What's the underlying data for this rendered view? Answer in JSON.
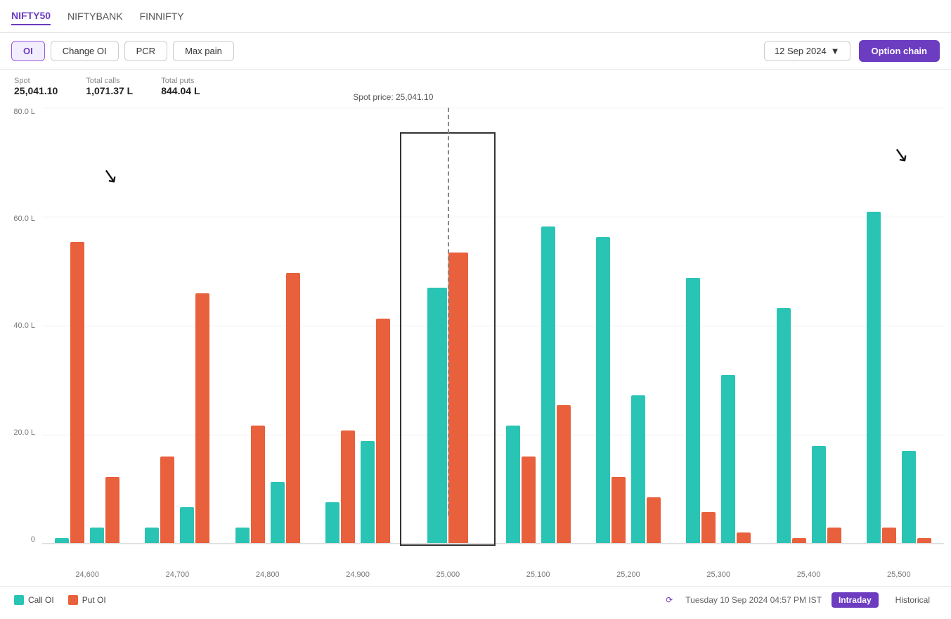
{
  "nav": {
    "items": [
      {
        "label": "NIFTY50",
        "active": true
      },
      {
        "label": "NIFTYBANK",
        "active": false
      },
      {
        "label": "FINNIFTY",
        "active": false
      }
    ]
  },
  "toolbar": {
    "filters": [
      {
        "label": "OI",
        "active": true
      },
      {
        "label": "Change OI",
        "active": false
      },
      {
        "label": "PCR",
        "active": false
      },
      {
        "label": "Max pain",
        "active": false
      }
    ],
    "date": "12 Sep 2024",
    "option_chain_btn": "Option chain"
  },
  "stats": {
    "spot_label": "Spot",
    "spot_value": "25,041.10",
    "total_calls_label": "Total calls",
    "total_calls_value": "1,071.37 L",
    "total_puts_label": "Total puts",
    "total_puts_value": "844.04 L"
  },
  "chart": {
    "spot_price_label": "Spot price: 25,041.10",
    "y_labels": [
      "80.0 L",
      "60.0 L",
      "40.0 L",
      "20.0 L",
      "0"
    ],
    "x_labels": [
      "24,600",
      "24,700",
      "24,800",
      "24,900",
      "25,000",
      "25,100",
      "25,200",
      "25,300",
      "25,400",
      "25,500"
    ],
    "highlighted_strike": "25,000",
    "bars": [
      {
        "strike": "24,600",
        "call": 1,
        "put": 59,
        "highlighted": false
      },
      {
        "strike": "24,600b",
        "call": 3,
        "put": 13,
        "highlighted": false
      },
      {
        "strike": "24,700",
        "call": 3,
        "put": 17,
        "highlighted": false
      },
      {
        "strike": "24,700b",
        "call": 7,
        "put": 49,
        "highlighted": false
      },
      {
        "strike": "24,800",
        "call": 3,
        "put": 23,
        "highlighted": false
      },
      {
        "strike": "24,800b",
        "call": 12,
        "put": 53,
        "highlighted": false
      },
      {
        "strike": "24,900",
        "call": 8,
        "put": 22,
        "highlighted": false
      },
      {
        "strike": "24,900b",
        "call": 20,
        "put": 44,
        "highlighted": false
      },
      {
        "strike": "25,000",
        "call": 50,
        "put": 57,
        "highlighted": true
      },
      {
        "strike": "25,100",
        "call": 23,
        "put": 17,
        "highlighted": false
      },
      {
        "strike": "25,100b",
        "call": 62,
        "put": 27,
        "highlighted": false
      },
      {
        "strike": "25,200",
        "call": 60,
        "put": 13,
        "highlighted": false
      },
      {
        "strike": "25,200b",
        "call": 29,
        "put": 9,
        "highlighted": false
      },
      {
        "strike": "25,300",
        "call": 52,
        "put": 6,
        "highlighted": false
      },
      {
        "strike": "25,300b",
        "call": 33,
        "put": 2,
        "highlighted": false
      },
      {
        "strike": "25,400",
        "call": 46,
        "put": 1,
        "highlighted": false
      },
      {
        "strike": "25,400b",
        "call": 19,
        "put": 3,
        "highlighted": false
      },
      {
        "strike": "25,500",
        "call": 65,
        "put": 3,
        "highlighted": false
      },
      {
        "strike": "25,500b",
        "call": 18,
        "put": 1,
        "highlighted": false
      }
    ]
  },
  "footer": {
    "legend": [
      {
        "label": "Call OI",
        "color": "#2ac4b5"
      },
      {
        "label": "Put OI",
        "color": "#e8603c"
      }
    ],
    "timestamp": "Tuesday 10 Sep 2024 04:57 PM IST",
    "intraday_btn": "Intraday",
    "historical_btn": "Historical"
  }
}
